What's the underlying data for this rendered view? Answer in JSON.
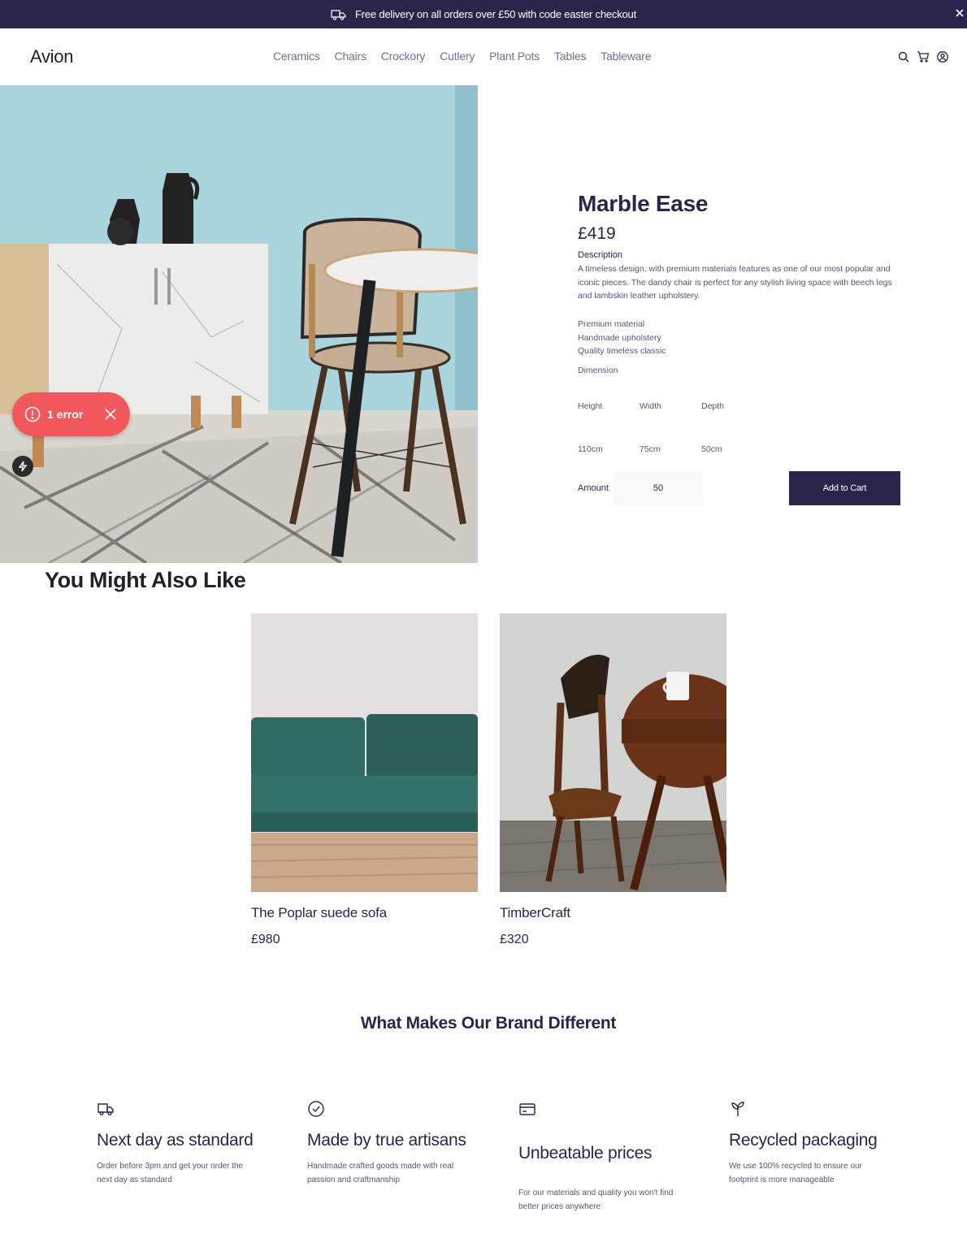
{
  "announcement": {
    "text": "Free delivery on all orders over £50 with code easter checkout"
  },
  "header": {
    "logo": "Avion",
    "nav": [
      "Ceramics",
      "Chairs",
      "Crockory",
      "Cutlery",
      "Plant Pots",
      "Tables",
      "Tableware"
    ]
  },
  "error_badge": {
    "label": "1 error"
  },
  "product": {
    "title": "Marble Ease",
    "price": "£419",
    "description_heading": "Description",
    "description": "A timeless design, with premium materials features as one of our most popular and iconic pieces. The dandy chair is perfect for any stylish living space with beech legs and lambskin leather upholstery.",
    "features": [
      "Premium material",
      "Handmade upholstery",
      "Quality timeless classic"
    ],
    "dimension_heading": "Dimension",
    "dimensions": {
      "headers": [
        "Height",
        "Width",
        "Depth"
      ],
      "values": [
        "110cm",
        "75cm",
        "50cm"
      ]
    },
    "amount_label": "Amount",
    "amount_value": "50",
    "add_to_cart": "Add to Cart"
  },
  "related": {
    "heading": "You Might Also Like",
    "items": [
      {
        "name": "The Poplar suede sofa",
        "price": "£980"
      },
      {
        "name": "TimberCraft",
        "price": "£320"
      }
    ]
  },
  "brand": {
    "heading": "What Makes Our Brand Different",
    "features": [
      {
        "icon": "delivery-truck-icon",
        "title": "Next day as standard",
        "text": "Order before 3pm and get your order the next day as standard"
      },
      {
        "icon": "checkmark-circle-icon",
        "title": "Made by true artisans",
        "text": "Handmade crafted goods made with real passion and craftmanship"
      },
      {
        "icon": "credit-card-icon",
        "title": "Unbeatable prices",
        "text": "For our materials and quality you won't find better prices anywhere"
      },
      {
        "icon": "sprout-icon",
        "title": "Recycled packaging",
        "text": "We use 100% recycled to ensure our footprint is more manageable"
      }
    ]
  },
  "colors": {
    "primary": "#2a254b",
    "muted": "#505977",
    "error": "#f2585b"
  }
}
